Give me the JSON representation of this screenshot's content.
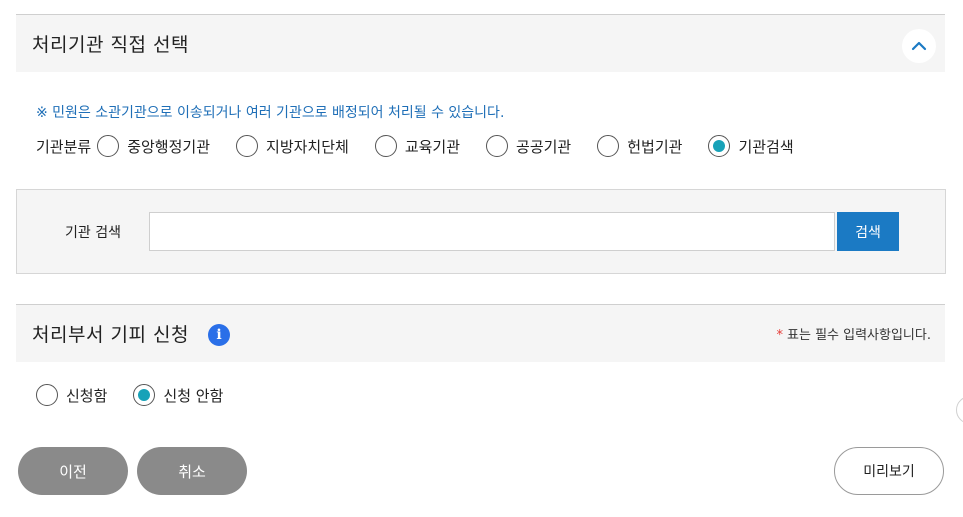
{
  "section1": {
    "title": "처리기관 직접 선택",
    "collapse_icon": "chevron-up-icon",
    "notice": "※ 민원은 소관기관으로 이송되거나 여러 기관으로 배정되어 처리될 수 있습니다.",
    "category_label": "기관분류",
    "options": [
      {
        "label": "중앙행정기관",
        "selected": false
      },
      {
        "label": "지방자치단체",
        "selected": false
      },
      {
        "label": "교육기관",
        "selected": false
      },
      {
        "label": "공공기관",
        "selected": false
      },
      {
        "label": "헌법기관",
        "selected": false
      },
      {
        "label": "기관검색",
        "selected": true
      }
    ]
  },
  "search": {
    "label": "기관 검색",
    "value": "",
    "button_label": "검색"
  },
  "section2": {
    "title": "처리부서 기피 신청",
    "info_icon": "info-icon",
    "required_star": "*",
    "required_text": "표는 필수 입력사항입니다.",
    "options": [
      {
        "label": "신청함",
        "selected": false
      },
      {
        "label": "신청 안함",
        "selected": true
      }
    ]
  },
  "footer": {
    "prev_label": "이전",
    "cancel_label": "취소",
    "preview_label": "미리보기"
  },
  "colors": {
    "accent_teal": "#17a2b8",
    "search_button": "#1b7ac4",
    "notice_text": "#1f6fb7",
    "info_icon": "#2a6fe8",
    "required_star": "#e53935",
    "gray_button": "#8a8a8a"
  }
}
